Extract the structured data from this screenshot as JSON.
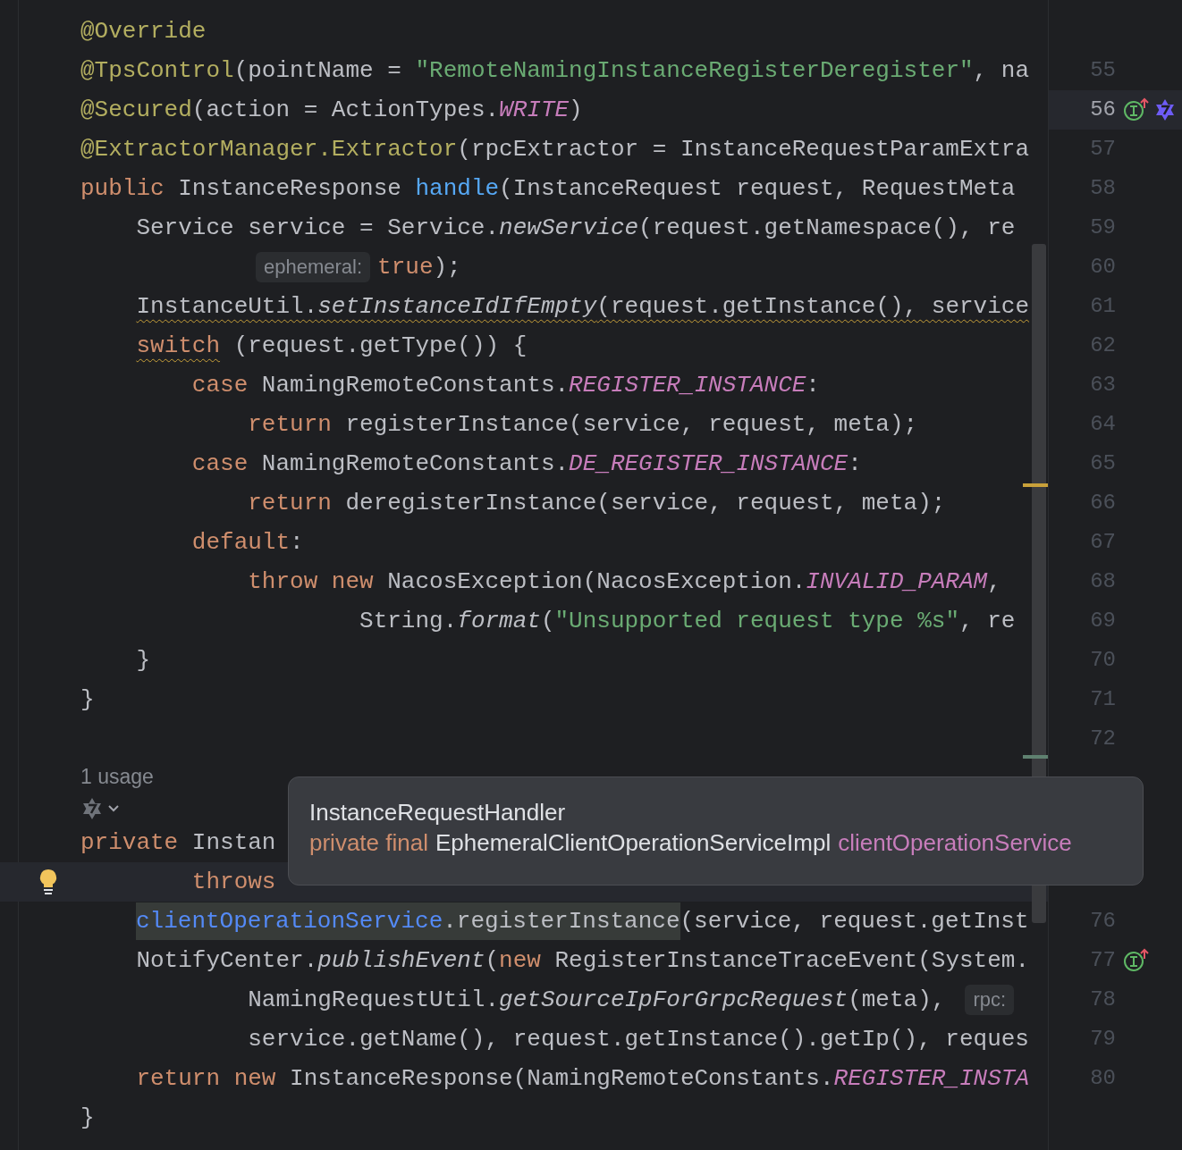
{
  "editor": {
    "rows": [
      {
        "kind": "code",
        "hovered": false,
        "current": false,
        "tokens": [
          {
            "kind": "annotation",
            "text": "@Override"
          }
        ]
      },
      {
        "kind": "code",
        "hovered": false,
        "current": false,
        "number": "55",
        "tokens": [
          {
            "kind": "annotation",
            "text": "@TpsControl"
          },
          {
            "kind": "plain",
            "text": "(pointName = "
          },
          {
            "kind": "string",
            "text": "\"RemoteNamingInstanceRegisterDeregister\""
          },
          {
            "kind": "plain",
            "text": ", na"
          }
        ]
      },
      {
        "kind": "code",
        "hovered": true,
        "current": false,
        "number": "56",
        "gutter_icons": [
          {
            "kind": "implements"
          },
          {
            "kind": "ai"
          }
        ],
        "tokens": [
          {
            "kind": "annotation",
            "text": "@Secured"
          },
          {
            "kind": "plain",
            "text": "(action = ActionTypes."
          },
          {
            "kind": "constant",
            "text": "WRITE"
          },
          {
            "kind": "plain",
            "text": ")"
          }
        ]
      },
      {
        "kind": "code",
        "hovered": false,
        "current": false,
        "number": "57",
        "tokens": [
          {
            "kind": "annotation",
            "text": "@ExtractorManager"
          },
          {
            "kind": "annotation",
            "text": ".Extractor"
          },
          {
            "kind": "plain",
            "text": "(rpcExtractor = InstanceRequestParamExtra"
          }
        ]
      },
      {
        "kind": "code",
        "hovered": false,
        "current": false,
        "number": "58",
        "tokens": [
          {
            "kind": "keyword",
            "text": "public"
          },
          {
            "kind": "plain",
            "text": " InstanceResponse "
          },
          {
            "kind": "method",
            "text": "handle"
          },
          {
            "kind": "plain",
            "text": "(InstanceRequest request, RequestMeta"
          }
        ]
      },
      {
        "kind": "code",
        "hovered": false,
        "current": false,
        "number": "59",
        "tokens": [
          {
            "kind": "plain",
            "text": "    Service service = Service."
          },
          {
            "kind": "call",
            "text": "newService"
          },
          {
            "kind": "plain",
            "text": "(request.getNamespace(), re"
          }
        ]
      },
      {
        "kind": "code",
        "hovered": false,
        "current": false,
        "number": "60",
        "tokens": [
          {
            "kind": "hint",
            "text": "ephemeral:"
          },
          {
            "kind": "keyword",
            "text": "true"
          },
          {
            "kind": "plain",
            "text": ");"
          }
        ]
      },
      {
        "kind": "code",
        "hovered": false,
        "current": false,
        "number": "61",
        "tokens": [
          {
            "kind": "warning",
            "tokens": [
              {
                "kind": "plain",
                "text": "    InstanceUtil."
              },
              {
                "kind": "call",
                "text": "setInstanceIdIfEmpty"
              },
              {
                "kind": "plain",
                "text": "(request.getInstance(), service"
              }
            ]
          }
        ]
      },
      {
        "kind": "code",
        "hovered": false,
        "current": false,
        "number": "62",
        "tokens": [
          {
            "kind": "warning",
            "tokens": [
              {
                "kind": "keyword",
                "text": "    switch"
              }
            ]
          },
          {
            "kind": "plain",
            "text": " (request.getType()) {"
          }
        ]
      },
      {
        "kind": "code",
        "hovered": false,
        "current": false,
        "number": "63",
        "tokens": [
          {
            "kind": "keyword",
            "text": "        case"
          },
          {
            "kind": "plain",
            "text": " NamingRemoteConstants."
          },
          {
            "kind": "constant",
            "text": "REGISTER_INSTANCE"
          },
          {
            "kind": "plain",
            "text": ":"
          }
        ]
      },
      {
        "kind": "code",
        "hovered": false,
        "current": false,
        "number": "64",
        "tokens": [
          {
            "kind": "keyword",
            "text": "            return"
          },
          {
            "kind": "plain",
            "text": " registerInstance(service, request, meta);"
          }
        ]
      },
      {
        "kind": "code",
        "hovered": false,
        "current": false,
        "number": "65",
        "tokens": [
          {
            "kind": "keyword",
            "text": "        case"
          },
          {
            "kind": "plain",
            "text": " NamingRemoteConstants."
          },
          {
            "kind": "constant",
            "text": "DE_REGISTER_INSTANCE"
          },
          {
            "kind": "plain",
            "text": ":"
          }
        ]
      },
      {
        "kind": "code",
        "hovered": false,
        "current": false,
        "number": "66",
        "tokens": [
          {
            "kind": "keyword",
            "text": "            return"
          },
          {
            "kind": "plain",
            "text": " deregisterInstance(service, request, meta);"
          }
        ]
      },
      {
        "kind": "code",
        "hovered": false,
        "current": false,
        "number": "67",
        "tokens": [
          {
            "kind": "keyword",
            "text": "        default"
          },
          {
            "kind": "plain",
            "text": ":"
          }
        ]
      },
      {
        "kind": "code",
        "hovered": false,
        "current": false,
        "number": "68",
        "tokens": [
          {
            "kind": "keyword",
            "text": "            throw new"
          },
          {
            "kind": "plain",
            "text": " NacosException(NacosException."
          },
          {
            "kind": "constant",
            "text": "INVALID_PARAM"
          },
          {
            "kind": "plain",
            "text": ","
          }
        ]
      },
      {
        "kind": "code",
        "hovered": false,
        "current": false,
        "number": "69",
        "tokens": [
          {
            "kind": "plain",
            "text": "                    String."
          },
          {
            "kind": "call",
            "text": "format"
          },
          {
            "kind": "plain",
            "text": "("
          },
          {
            "kind": "string",
            "text": "\"Unsupported request type %s\""
          },
          {
            "kind": "plain",
            "text": ", re"
          }
        ]
      },
      {
        "kind": "code",
        "hovered": false,
        "current": false,
        "number": "70",
        "tokens": [
          {
            "kind": "plain",
            "text": "    }"
          }
        ]
      },
      {
        "kind": "code",
        "hovered": false,
        "current": false,
        "number": "71",
        "tokens": [
          {
            "kind": "plain",
            "text": "}"
          }
        ]
      },
      {
        "kind": "code",
        "hovered": false,
        "current": false,
        "number": "72"
      },
      {
        "kind": "usages",
        "text": "1 usage"
      },
      {
        "kind": "actions"
      },
      {
        "kind": "code",
        "hovered": false,
        "current": false,
        "tokens": [
          {
            "kind": "keyword",
            "text": "private"
          },
          {
            "kind": "plain",
            "text": " Instan"
          }
        ]
      },
      {
        "kind": "code",
        "hovered": false,
        "current": true,
        "bulb": true,
        "tokens": [
          {
            "kind": "keyword",
            "text": "        throws"
          }
        ]
      },
      {
        "kind": "code",
        "hovered": false,
        "current": false,
        "number": "76",
        "tokens": [
          {
            "kind": "field",
            "text": "clientOperationService"
          },
          {
            "kind": "marked",
            "text": ".registerInstance"
          },
          {
            "kind": "plain",
            "text": "(service, request.getInst"
          }
        ]
      },
      {
        "kind": "code",
        "hovered": false,
        "current": false,
        "number": "77",
        "gutter_icons": [
          {
            "kind": "implements"
          }
        ],
        "tokens": [
          {
            "kind": "plain",
            "text": "    NotifyCenter."
          },
          {
            "kind": "call",
            "text": "publishEvent"
          },
          {
            "kind": "plain",
            "text": "("
          },
          {
            "kind": "keyword",
            "text": "new"
          },
          {
            "kind": "plain",
            "text": " RegisterInstanceTraceEvent(System."
          }
        ]
      },
      {
        "kind": "code",
        "hovered": false,
        "current": false,
        "number": "78",
        "tokens": [
          {
            "kind": "plain",
            "text": "            NamingRequestUtil."
          },
          {
            "kind": "call",
            "text": "getSourceIpForGrpcRequest"
          },
          {
            "kind": "plain",
            "text": "(meta),"
          },
          {
            "kind": "hint",
            "text": "rpc:"
          }
        ]
      },
      {
        "kind": "code",
        "hovered": false,
        "current": false,
        "number": "79",
        "tokens": [
          {
            "kind": "plain",
            "text": "            service.getName(), request.getInstance().getIp(), reques"
          }
        ]
      },
      {
        "kind": "code",
        "hovered": false,
        "current": false,
        "number": "80",
        "tokens": [
          {
            "kind": "keyword",
            "text": "    return new"
          },
          {
            "kind": "plain",
            "text": " InstanceResponse(NamingRemoteConstants."
          },
          {
            "kind": "constant",
            "text": "REGISTER_INSTA"
          }
        ]
      },
      {
        "kind": "code",
        "hovered": false,
        "current": false,
        "tokens": [
          {
            "kind": "plain",
            "text": "}"
          }
        ]
      }
    ]
  },
  "tooltip": {
    "title": "InstanceRequestHandler",
    "declaration": [
      {
        "kind": "keyword",
        "text": "private final"
      },
      {
        "kind": "type",
        "text": "EphemeralClientOperationServiceImpl"
      },
      {
        "kind": "field",
        "text": "clientOperationService"
      }
    ]
  }
}
